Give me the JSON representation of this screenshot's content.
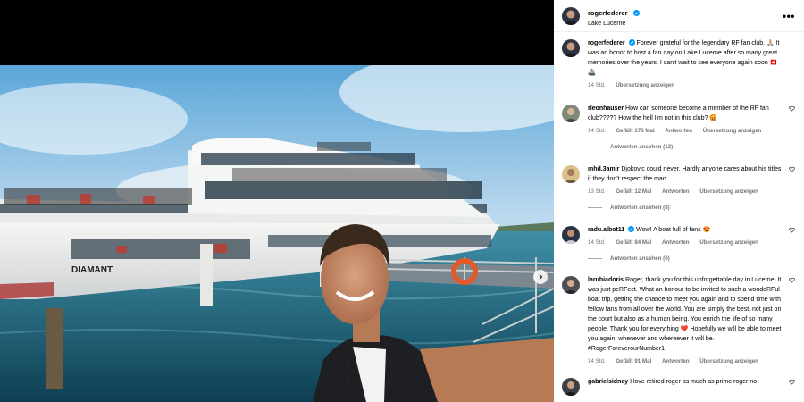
{
  "post": {
    "username": "rogerfederer",
    "location": "Lake Lucerne"
  },
  "caption": {
    "username": "rogerfederer",
    "text": "Forever grateful for the legendary RF fan club. 🙏🏼 It was an honor to host a fan day on Lake Lucerne after so many great memories over the years. I can't wait to see everyone again soon 🇨🇭🚢",
    "time": "14 Std.",
    "translate": "Übersetzung anzeigen"
  },
  "photo": {
    "boat_name": "DIAMANT"
  },
  "comments": [
    {
      "username": "rleonhauser",
      "text": "How can someone become a member of the RF fan club????? How the hell I'm not in this club? 😡",
      "time": "14 Std.",
      "likes": "Gefällt 176 Mal",
      "reply": "Antworten",
      "translate": "Übersetzung anzeigen",
      "replies": "Antworten ansehen (12)"
    },
    {
      "username": "mhd.3amir",
      "text": "Djokovic could never. Hardly anyone cares about his titles if they don't respect the man.",
      "time": "13 Std.",
      "likes": "Gefällt 12 Mal",
      "reply": "Antworten",
      "translate": "Übersetzung anzeigen",
      "replies": "Antworten ansehen (8)"
    },
    {
      "username": "radu.albot11",
      "text": "Wow! A boat full of fans 😍",
      "time": "14 Std.",
      "likes": "Gefällt 84 Mal",
      "reply": "Antworten",
      "translate": "Übersetzung anzeigen",
      "replies": "Antworten ansehen (6)"
    },
    {
      "username": "larubiadoris",
      "text": "Roger, thank you for this unforgettable day in Lucerne. It was just peRFect. What an honour to be invited to such a wondeRFul boat trip, getting the chance to meet you again and to spend time with fellow fans from all over the world. You are simply the best, not just on the court but also as a human being. You enrich the life of so many people. Thank you for everything ❤️ Hopefully we will be able to meet you again, whenever and whereever it will be. #RogerForeverourNumber1",
      "time": "14 Std.",
      "likes": "Gefällt 91 Mal",
      "reply": "Antworten",
      "translate": "Übersetzung anzeigen"
    },
    {
      "username": "gabrielsidney",
      "text": "I love retired roger as much as prime roger no"
    }
  ],
  "colors": {
    "verified": "#0095f6",
    "meta": "#737373",
    "divider": "#efefef"
  },
  "icons": {
    "more": "more-options-icon",
    "heart": "heart-outline-icon",
    "next": "chevron-right-icon",
    "verified": "verified-badge-icon"
  }
}
